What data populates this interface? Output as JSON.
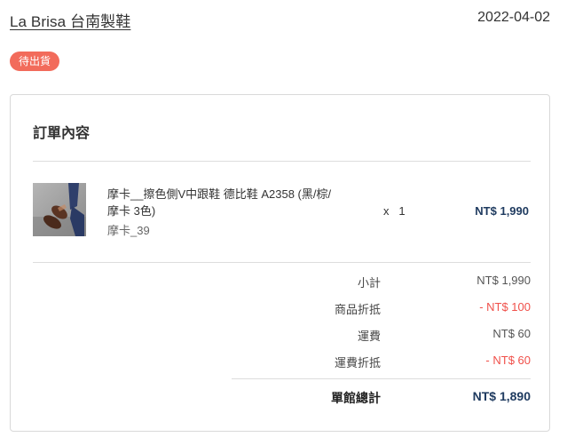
{
  "header": {
    "shop_name": "La Brisa 台南製鞋",
    "date": "2022-04-02",
    "status": "待出貨"
  },
  "order": {
    "title": "訂單內容",
    "item": {
      "name": "摩卡__擦色側V中跟鞋 德比鞋 A2358 (黑/棕/摩卡 3色)",
      "variant": "摩卡_39",
      "quantity": "x   1",
      "price": "NT$ 1,990"
    },
    "summary": [
      {
        "label": "小計",
        "value": "NT$ 1,990",
        "type": "normal"
      },
      {
        "label": "商品折抵",
        "value": "- NT$ 100",
        "type": "discount"
      },
      {
        "label": "運費",
        "value": "NT$ 60",
        "type": "normal"
      },
      {
        "label": "運費折抵",
        "value": "- NT$ 60",
        "type": "discount"
      }
    ],
    "total": {
      "label": "單館總計",
      "value": "NT$ 1,890"
    }
  },
  "colors": {
    "badge": "#f26b5b",
    "price": "#1e3a5f",
    "discount": "#f0504a"
  }
}
